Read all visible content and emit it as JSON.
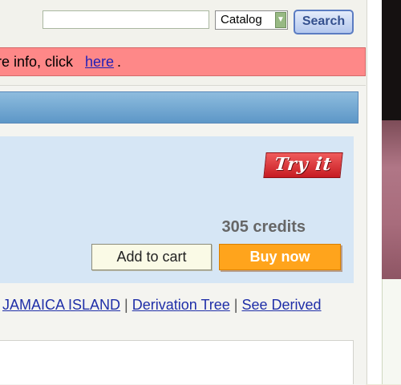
{
  "search": {
    "placeholder": "",
    "catalog_option": "Catalog",
    "button_label": "Search"
  },
  "info_bar": {
    "text": "re info, click ",
    "link": "here",
    "end": "."
  },
  "product": {
    "try_label": "Try it",
    "credits": "305 credits",
    "add_to_cart": "Add to cart",
    "buy_now": "Buy now"
  },
  "links": [
    {
      "label": "JAMAICA ISLAND"
    },
    {
      "label": "Derivation Tree"
    },
    {
      "label": "See Derived"
    }
  ],
  "separator": "|",
  "colors": {
    "info_bg": "#fe8888",
    "buy_bg": "#ffa41c",
    "panel_bg": "#d6e6f5",
    "bar_blue": "#6ea4cf"
  }
}
